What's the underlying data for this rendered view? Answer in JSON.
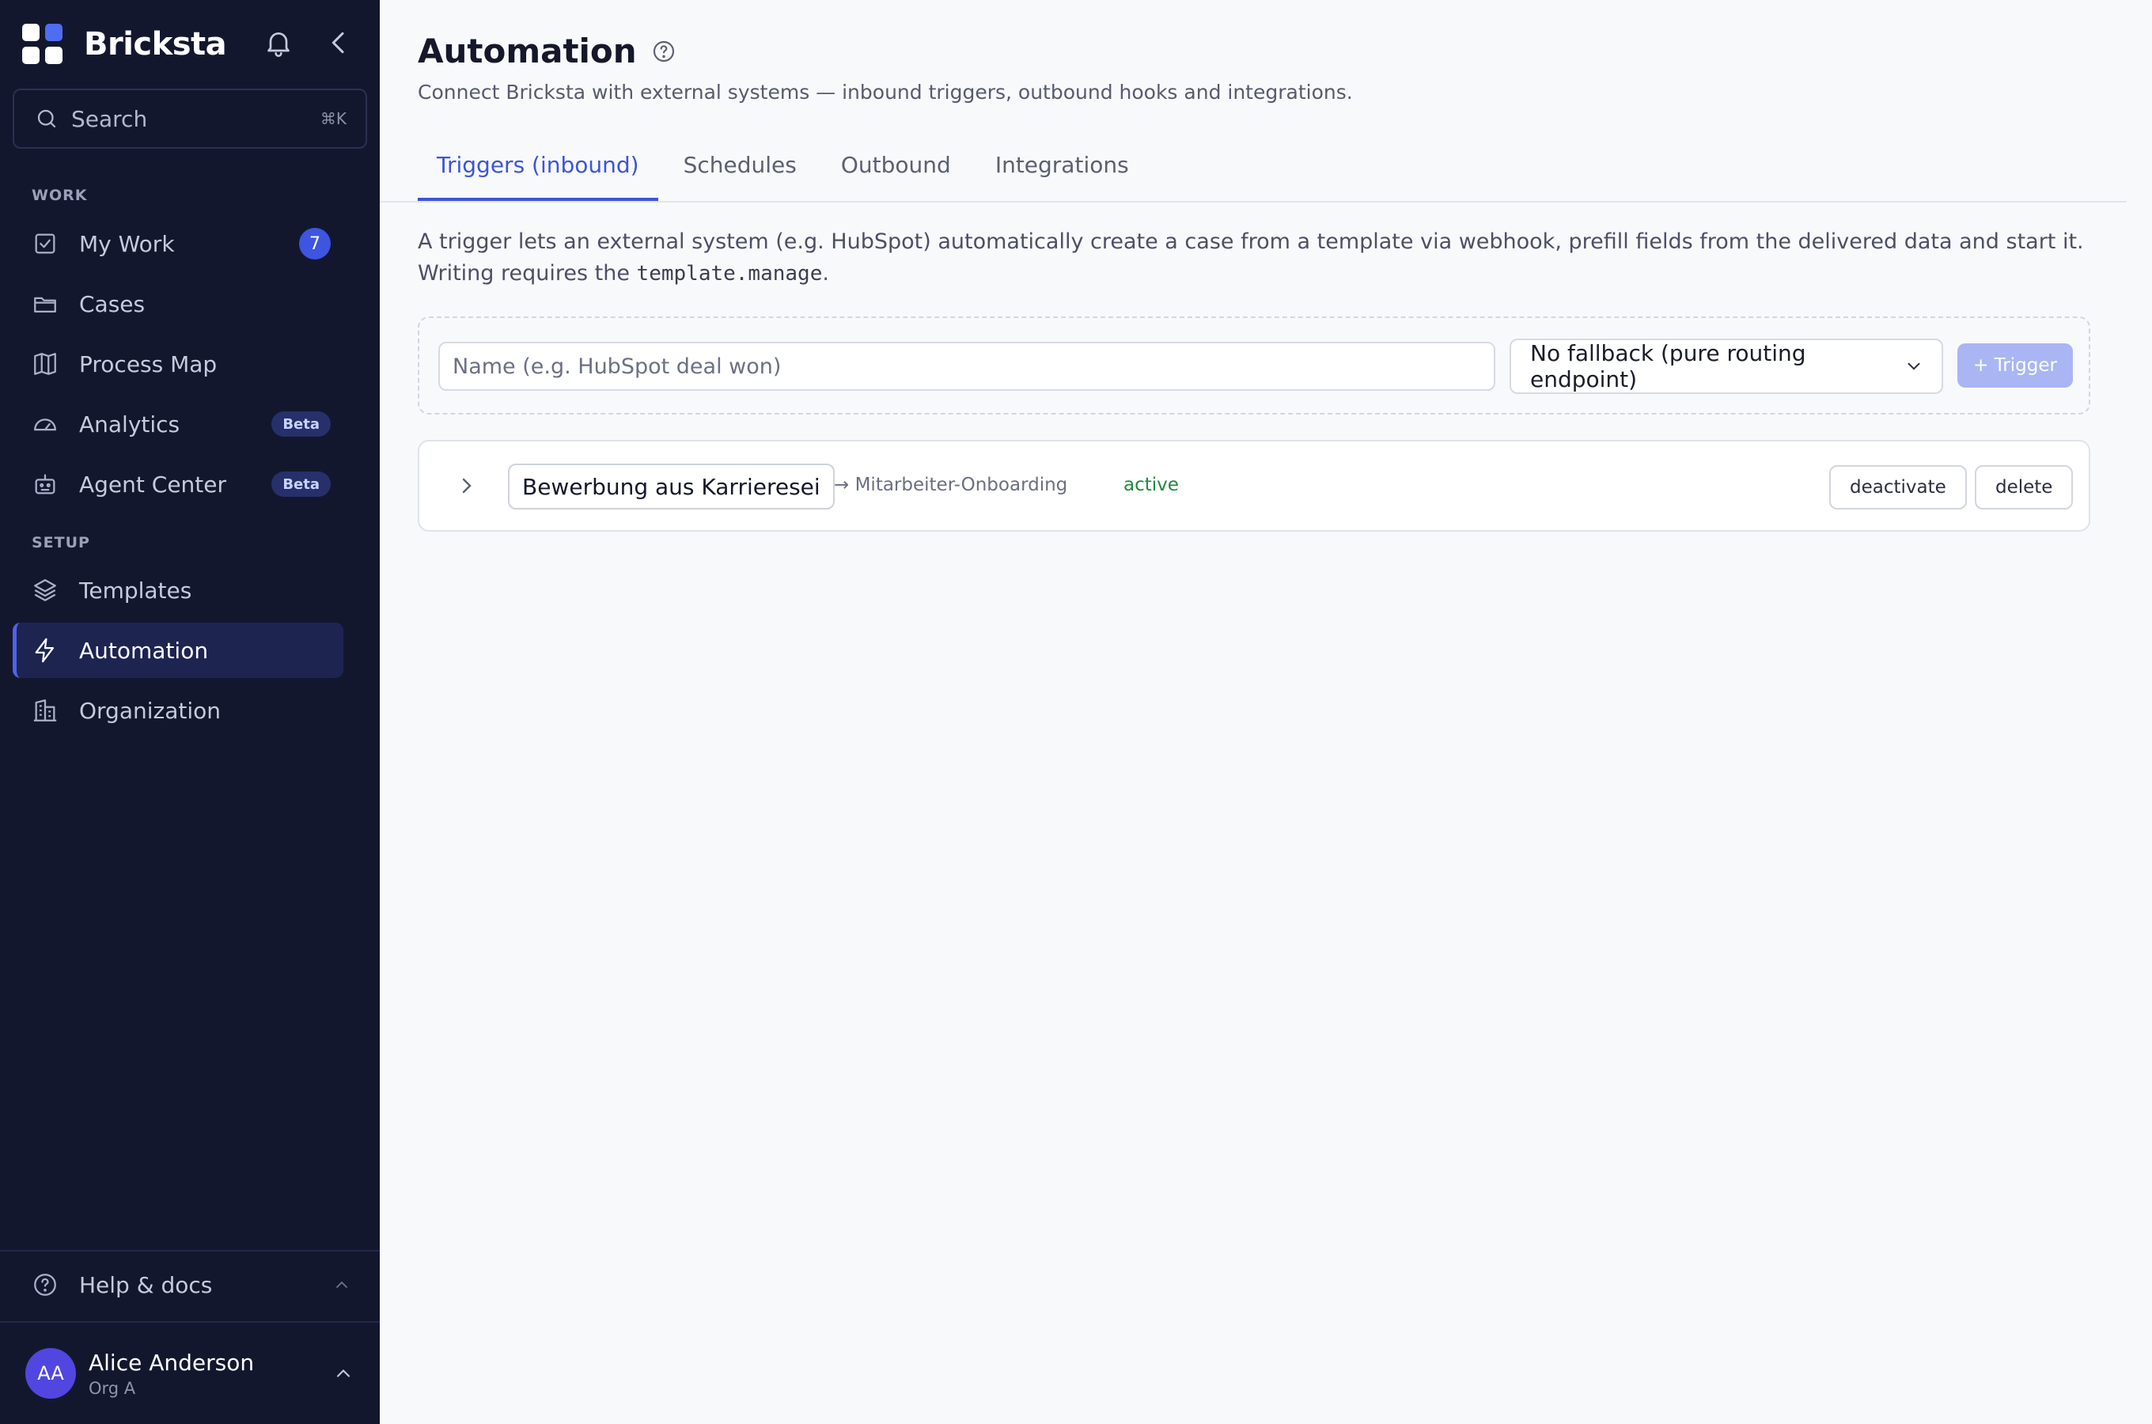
{
  "app": {
    "brand": "Bricksta"
  },
  "search": {
    "label": "Search",
    "shortcut": "⌘K"
  },
  "sidebar": {
    "work_label": "WORK",
    "setup_label": "SETUP",
    "items": [
      {
        "label": "My Work",
        "icon": "checkbox-icon",
        "badge": "7"
      },
      {
        "label": "Cases",
        "icon": "folder-icon"
      },
      {
        "label": "Process Map",
        "icon": "map-icon"
      },
      {
        "label": "Analytics",
        "icon": "gauge-icon",
        "badge": "Beta"
      },
      {
        "label": "Agent Center",
        "icon": "robot-icon",
        "badge": "Beta"
      },
      {
        "label": "Templates",
        "icon": "layers-icon"
      },
      {
        "label": "Automation",
        "icon": "bolt-icon",
        "active": true
      },
      {
        "label": "Organization",
        "icon": "building-icon"
      }
    ],
    "help": {
      "label": "Help & docs"
    }
  },
  "user": {
    "initials": "AA",
    "name": "Alice Anderson",
    "org": "Org A"
  },
  "page": {
    "title": "Automation",
    "subtitle": "Connect Bricksta with external systems — inbound triggers, outbound hooks and integrations.",
    "tabs": [
      {
        "label": "Triggers (inbound)",
        "active": true
      },
      {
        "label": "Schedules"
      },
      {
        "label": "Outbound"
      },
      {
        "label": "Integrations"
      }
    ],
    "description_main": "A trigger lets an external system (e.g. HubSpot) automatically create a case from a template via webhook, prefill fields from the delivered data and start it. Writing requires the ",
    "description_code": "template.manage",
    "description_end": "."
  },
  "new_trigger": {
    "name_placeholder": "Name (e.g. HubSpot deal won)",
    "name_value": "",
    "fallback_selected": "No fallback (pure routing endpoint)",
    "add_label": "+ Trigger"
  },
  "triggers": [
    {
      "name": "Bewerbung aus Karrieresei",
      "target": "→ Mitarbeiter-Onboarding",
      "status": "active",
      "deactivate_label": "deactivate",
      "delete_label": "delete"
    }
  ],
  "colors": {
    "sidebar_bg": "#13172e",
    "accent": "#3b55d9",
    "status_active": "#1f8a3c"
  }
}
